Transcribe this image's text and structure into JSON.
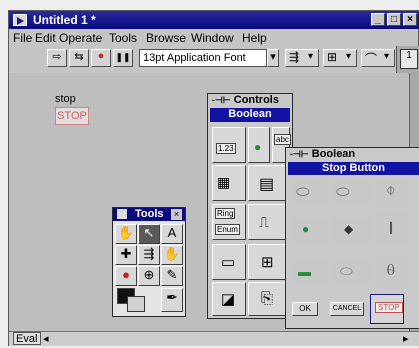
{
  "window": {
    "title": "Untitled 1 *",
    "min_glyph": "_",
    "max_glyph": "□",
    "close_glyph": "×"
  },
  "menu": [
    "File",
    "Edit",
    "Operate",
    "Tools",
    "Browse",
    "Window",
    "Help"
  ],
  "toolbar": {
    "run_glyph": "⇨",
    "run_cont_glyph": "⇆",
    "abort_glyph": "●",
    "pause_glyph": "❚❚",
    "font": "13pt Application Font",
    "dropdown_glyph": "▾"
  },
  "front_panel": {
    "stop_label": "stop",
    "stop_button_text": "STOP"
  },
  "controls_palette": {
    "title": "Controls",
    "subtitle": "Boolean",
    "numeric_label": "1.23",
    "string_label": "abc",
    "ring_label": "Ring",
    "enum_label": "Enum"
  },
  "boolean_palette": {
    "title": "Boolean",
    "tooltip": "Stop Button",
    "ok_label": "OK",
    "cancel_label": "CANCEL",
    "stop_label": "STOP"
  },
  "tools_palette": {
    "title": "Tools",
    "close_glyph": "×",
    "tools": [
      "✋",
      "↖",
      "A",
      "✚",
      "⇶",
      "✋",
      "●",
      "⊕",
      "✎",
      "",
      "✒",
      ""
    ]
  },
  "bottom": {
    "mode_label": "Eval",
    "left_arrow": "◂",
    "right_arrow": "▸"
  },
  "vi_icon_label": "1"
}
